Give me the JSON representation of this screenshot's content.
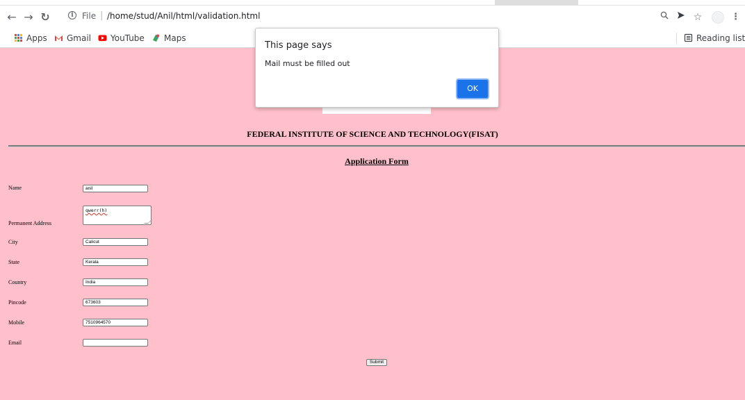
{
  "browser": {
    "url_scheme": "File",
    "url_path": "/home/stud/Anil/html/validation.html",
    "bookmarks": {
      "apps": "Apps",
      "gmail": "Gmail",
      "youtube": "YouTube",
      "maps": "Maps",
      "reading_list": "Reading list"
    }
  },
  "page": {
    "institute_title": "FEDERAL INSTITUTE OF SCIENCE AND TECHNOLOGY(FISAT)",
    "form_title": "Application Form",
    "fields": {
      "name": {
        "label": "Name",
        "value": "anil"
      },
      "address": {
        "label": "Permanent Address",
        "value": "qwerr(h)"
      },
      "city": {
        "label": "City",
        "value": "Calicut"
      },
      "state": {
        "label": "State",
        "value": "Kerala"
      },
      "country": {
        "label": "Country",
        "value": "India"
      },
      "pincode": {
        "label": "Pincode",
        "value": "673603"
      },
      "mobile": {
        "label": "Mobile",
        "value": "7510964570"
      },
      "email": {
        "label": "Email",
        "value": ""
      }
    },
    "submit_label": "Submit"
  },
  "dialog": {
    "title": "This page says",
    "message": "Mail must be filled out",
    "ok_label": "OK"
  },
  "colors": {
    "page_background": "#ffc0cb",
    "dialog_button": "#1a73e8"
  },
  "icons": [
    "back-icon",
    "forward-icon",
    "reload-icon",
    "info-icon",
    "zoom-icon",
    "send-icon",
    "star-icon",
    "menu-icon",
    "apps-icon",
    "gmail-icon",
    "youtube-icon",
    "maps-icon",
    "reading-list-icon"
  ]
}
